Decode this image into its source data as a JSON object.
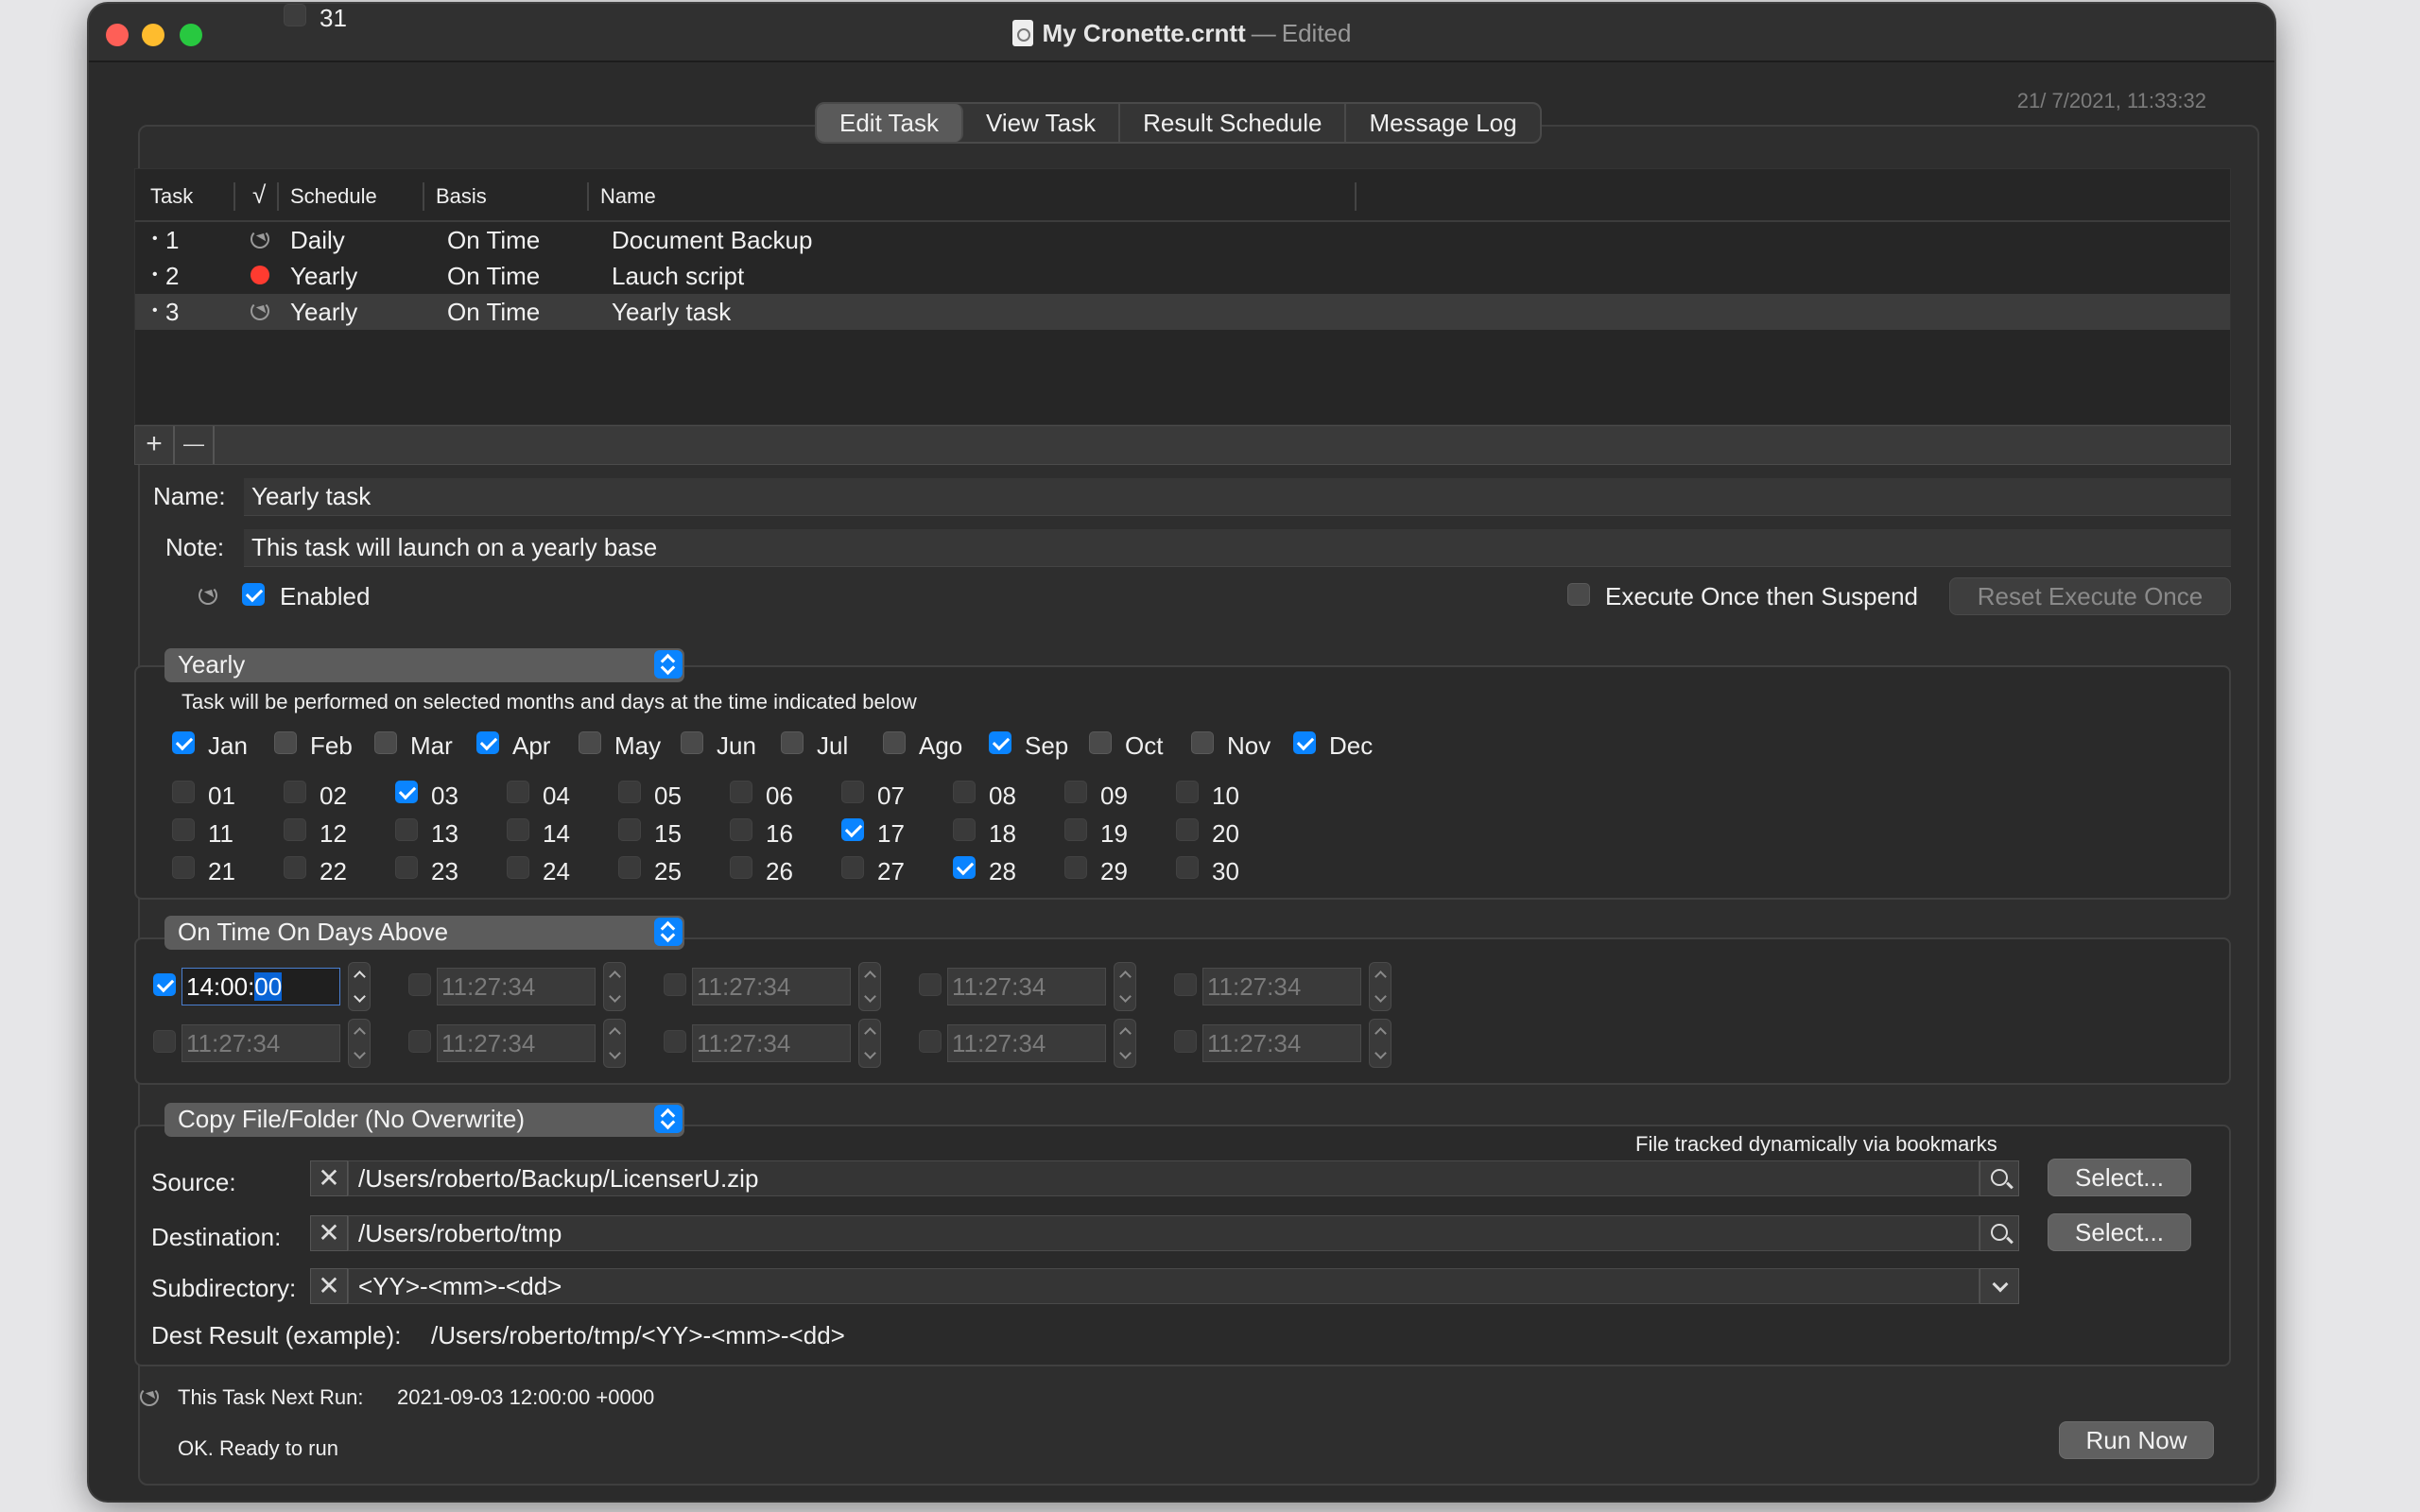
{
  "window": {
    "title": "My Cronette.crntt",
    "title_sep": "—",
    "title_state": "Edited",
    "timestamp": "21/ 7/2021, 11:33:32"
  },
  "tabs": [
    "Edit Task",
    "View Task",
    "Result Schedule",
    "Message Log"
  ],
  "active_tab": "Edit Task",
  "table": {
    "headers": {
      "task": "Task",
      "check": "√",
      "schedule": "Schedule",
      "basis": "Basis",
      "name": "Name"
    },
    "rows": [
      {
        "bullet": "•",
        "task": "1",
        "status_icon": "repeat-icon",
        "schedule": "Daily",
        "basis": "On Time",
        "name": "Document Backup"
      },
      {
        "bullet": "•",
        "task": "2",
        "status_icon": "red-dot-icon",
        "schedule": "Yearly",
        "basis": "On Time",
        "name": "Lauch script"
      },
      {
        "bullet": "•",
        "task": "3",
        "status_icon": "repeat-icon",
        "schedule": "Yearly",
        "basis": "On Time",
        "name": "Yearly task"
      }
    ],
    "selected_row": 3,
    "add_label": "+",
    "remove_label": "—"
  },
  "task": {
    "name_label": "Name:",
    "name_value": "Yearly task",
    "note_label": "Note:",
    "note_value": "This task will launch on a yearly base",
    "enabled_label": "Enabled",
    "enabled": true,
    "execute_once_label": "Execute Once then Suspend",
    "execute_once": false,
    "reset_label": "Reset Execute Once"
  },
  "schedule": {
    "type": "Yearly",
    "description": "Task will be performed on selected months and days at the time indicated below",
    "months": [
      {
        "label": "Jan",
        "checked": true
      },
      {
        "label": "Feb",
        "checked": false
      },
      {
        "label": "Mar",
        "checked": false
      },
      {
        "label": "Apr",
        "checked": true
      },
      {
        "label": "May",
        "checked": false
      },
      {
        "label": "Jun",
        "checked": false
      },
      {
        "label": "Jul",
        "checked": false
      },
      {
        "label": "Ago",
        "checked": false
      },
      {
        "label": "Sep",
        "checked": true
      },
      {
        "label": "Oct",
        "checked": false
      },
      {
        "label": "Nov",
        "checked": false
      },
      {
        "label": "Dec",
        "checked": true
      }
    ],
    "days_checked": [
      "03",
      "17",
      "28"
    ]
  },
  "timing": {
    "type": "On Time On Days Above",
    "active_value_prefix": "14:00:",
    "active_value_selected": "00",
    "inactive_value": "11:27:34"
  },
  "action": {
    "type": "Copy File/Folder (No Overwrite)",
    "tracking_note": "File tracked dynamically via bookmarks",
    "source_label": "Source:",
    "source_value": "/Users/roberto/Backup/LicenserU.zip",
    "destination_label": "Destination:",
    "destination_value": "/Users/roberto/tmp",
    "subdirectory_label": "Subdirectory:",
    "subdirectory_value": "<YY>-<mm>-<dd>",
    "dest_result_label": "Dest Result (example):",
    "dest_result_value": "/Users/roberto/tmp/<YY>-<mm>-<dd>",
    "select_label": "Select...",
    "clear_glyph": "✕"
  },
  "footer": {
    "next_run_label": "This Task Next Run:",
    "next_run_value": "2021-09-03 12:00:00 +0000",
    "status": "OK. Ready to run",
    "run_now_label": "Run Now"
  }
}
